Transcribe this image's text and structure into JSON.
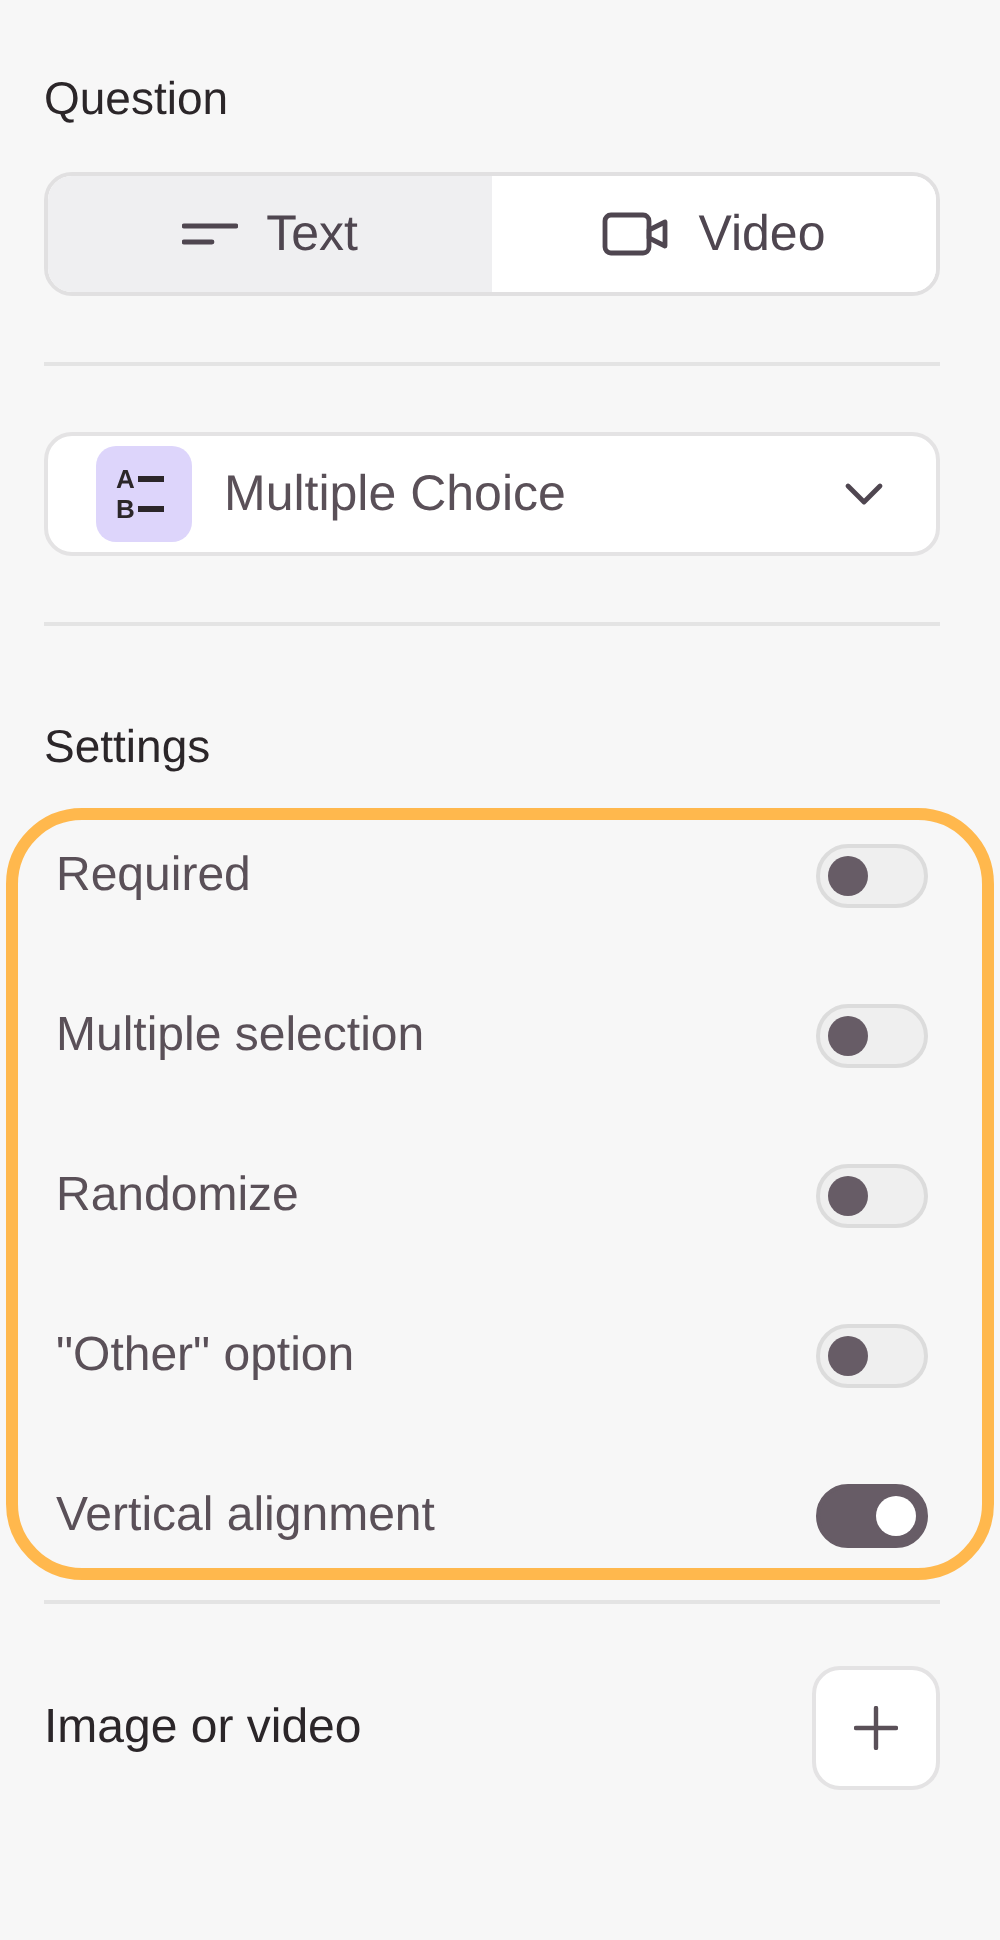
{
  "question": {
    "title": "Question",
    "tabs": [
      {
        "label": "Text",
        "kind": "text",
        "selected": true
      },
      {
        "label": "Video",
        "kind": "video",
        "selected": false
      }
    ],
    "type_select": {
      "icon_letters": [
        "A",
        "B"
      ],
      "value": "Multiple Choice"
    }
  },
  "settings": {
    "title": "Settings",
    "highlighted": true,
    "items": [
      {
        "label": "Required",
        "on": false
      },
      {
        "label": "Multiple selection",
        "on": false
      },
      {
        "label": "Randomize",
        "on": false
      },
      {
        "label": "\"Other\" option",
        "on": false
      },
      {
        "label": "Vertical alignment",
        "on": true
      }
    ]
  },
  "media": {
    "label": "Image or video"
  }
}
